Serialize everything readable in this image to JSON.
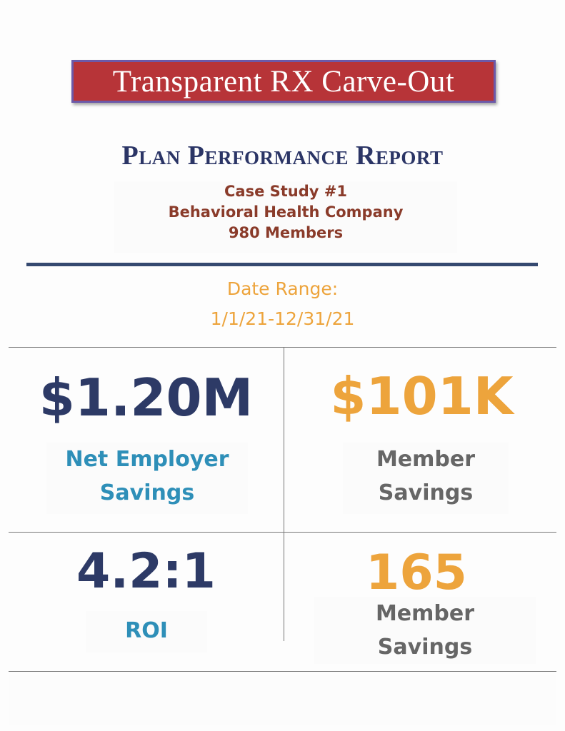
{
  "header": {
    "banner_title": "Transparent RX Carve-Out",
    "report_title": "Plan Performance Report"
  },
  "case_study": {
    "line1": "Case Study #1",
    "line2": "Behavioral Health Company",
    "line3": "980 Members"
  },
  "date_range": {
    "label": "Date Range:",
    "value": "1/1/21-12/31/21"
  },
  "metrics": {
    "net_employer": {
      "value": "$1.20M",
      "label_line1": "Net Employer",
      "label_line2": "Savings"
    },
    "member_savings": {
      "value": "$101K",
      "label_line1": "Member",
      "label_line2": "Savings"
    },
    "roi": {
      "value": "4.2:1",
      "label": "ROI"
    },
    "member_count": {
      "value": "165",
      "label_line1": "Member",
      "label_line2": "Savings"
    }
  },
  "colors": {
    "banner_bg": "#b73438",
    "navy": "#2d3a66",
    "gold": "#eda43c",
    "blue": "#2e8fb8",
    "grey": "#666666",
    "brown": "#8a3b2a"
  }
}
